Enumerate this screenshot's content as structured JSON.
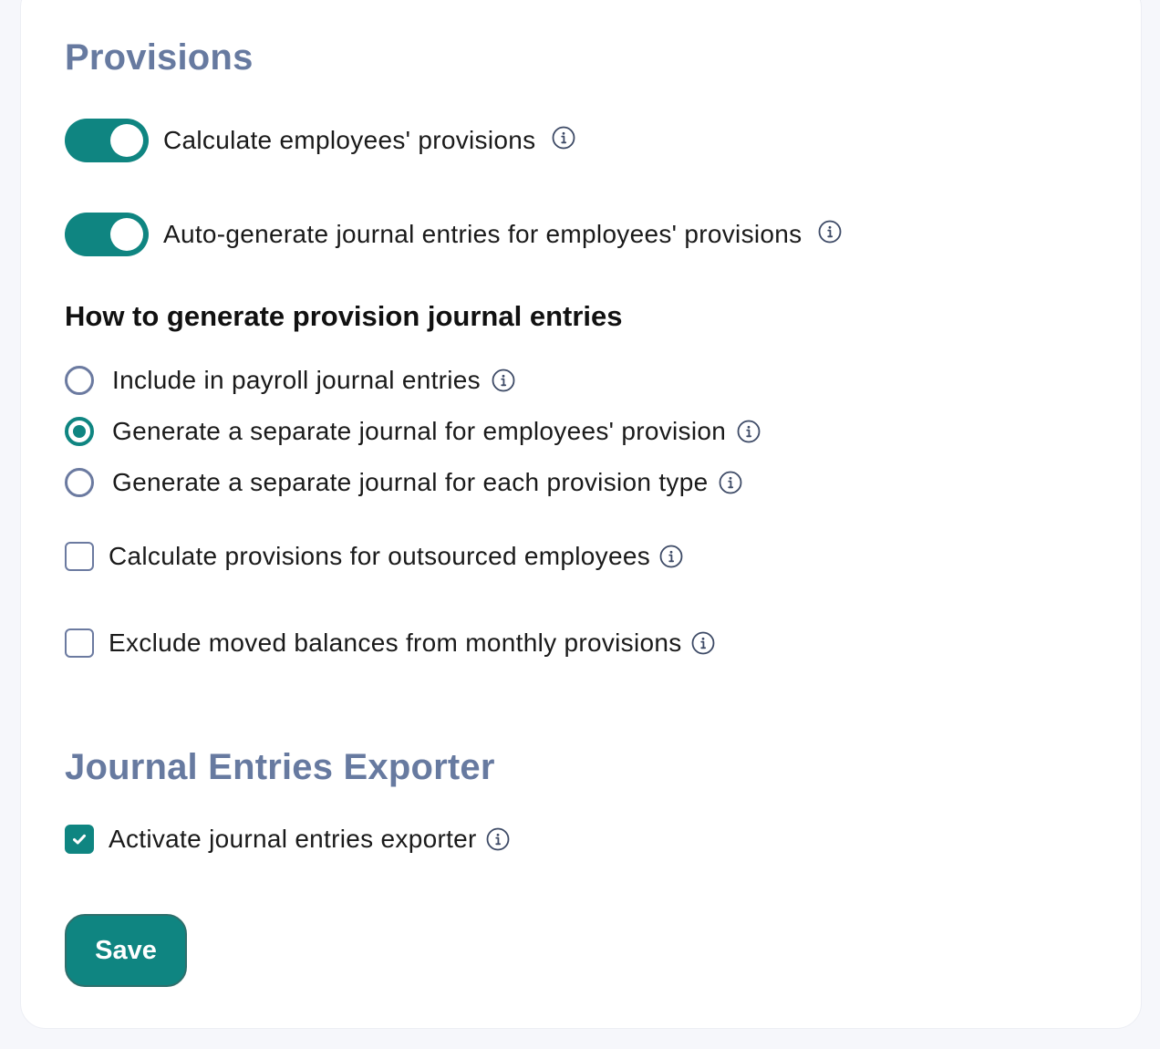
{
  "provisions": {
    "title": "Provisions",
    "toggle_calculate": {
      "label": "Calculate employees' provisions",
      "on": true
    },
    "toggle_autogenerate": {
      "label": "Auto-generate journal entries for employees' provisions",
      "on": true
    },
    "how_to_heading": "How to generate provision journal entries",
    "radio_options": [
      {
        "label": "Include in payroll journal entries",
        "selected": false
      },
      {
        "label": "Generate a separate journal for employees' provision",
        "selected": true
      },
      {
        "label": "Generate a separate journal for each provision type",
        "selected": false
      }
    ],
    "checkbox_outsourced": {
      "label": "Calculate provisions for outsourced employees",
      "checked": false
    },
    "checkbox_exclude_moved": {
      "label": "Exclude moved balances from monthly provisions",
      "checked": false
    }
  },
  "exporter": {
    "title": "Journal Entries Exporter",
    "checkbox_activate": {
      "label": "Activate journal entries exporter",
      "checked": true
    }
  },
  "save_label": "Save",
  "colors": {
    "accent": "#0f8581",
    "section_title": "#677aa0",
    "control_border": "#6b7aa0",
    "page_background": "#f6f7fb"
  },
  "icons": {
    "info": "info-icon",
    "check": "checkmark-icon"
  }
}
